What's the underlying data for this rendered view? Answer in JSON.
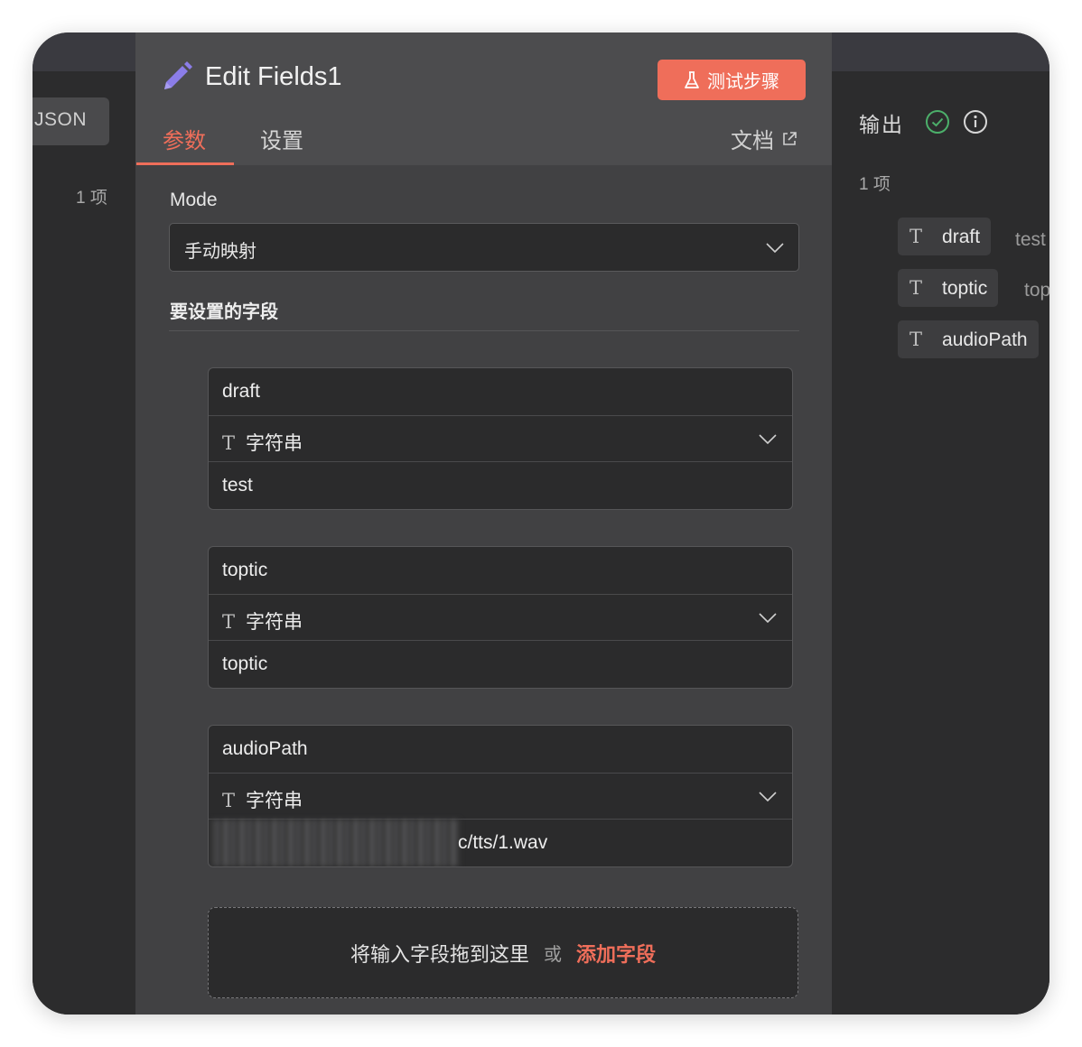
{
  "left_panel": {
    "json_tab": "JSON",
    "item_count": "1 项"
  },
  "modal": {
    "title": "Edit Fields1",
    "test_button": "测试步骤",
    "tabs": {
      "params": "参数",
      "settings": "设置"
    },
    "docs": "文档",
    "mode_label": "Mode",
    "mode_value": "手动映射",
    "fields_label": "要设置的字段",
    "fields": [
      {
        "name": "draft",
        "type": "字符串",
        "value": "test"
      },
      {
        "name": "toptic",
        "type": "字符串",
        "value": "toptic"
      },
      {
        "name": "audioPath",
        "type": "字符串",
        "value": "c/tts/1.wav"
      }
    ],
    "drop_text": "将输入字段拖到这里",
    "drop_or": "或",
    "add_field": "添加字段",
    "accent_color": "#ef6e5a"
  },
  "output_panel": {
    "title": "输出",
    "status_icon": "check-circle-icon",
    "item_count": "1 项",
    "items": [
      {
        "name": "draft",
        "value": "test"
      },
      {
        "name": "toptic",
        "value": "top"
      },
      {
        "name": "audioPath",
        "value": ""
      }
    ]
  }
}
